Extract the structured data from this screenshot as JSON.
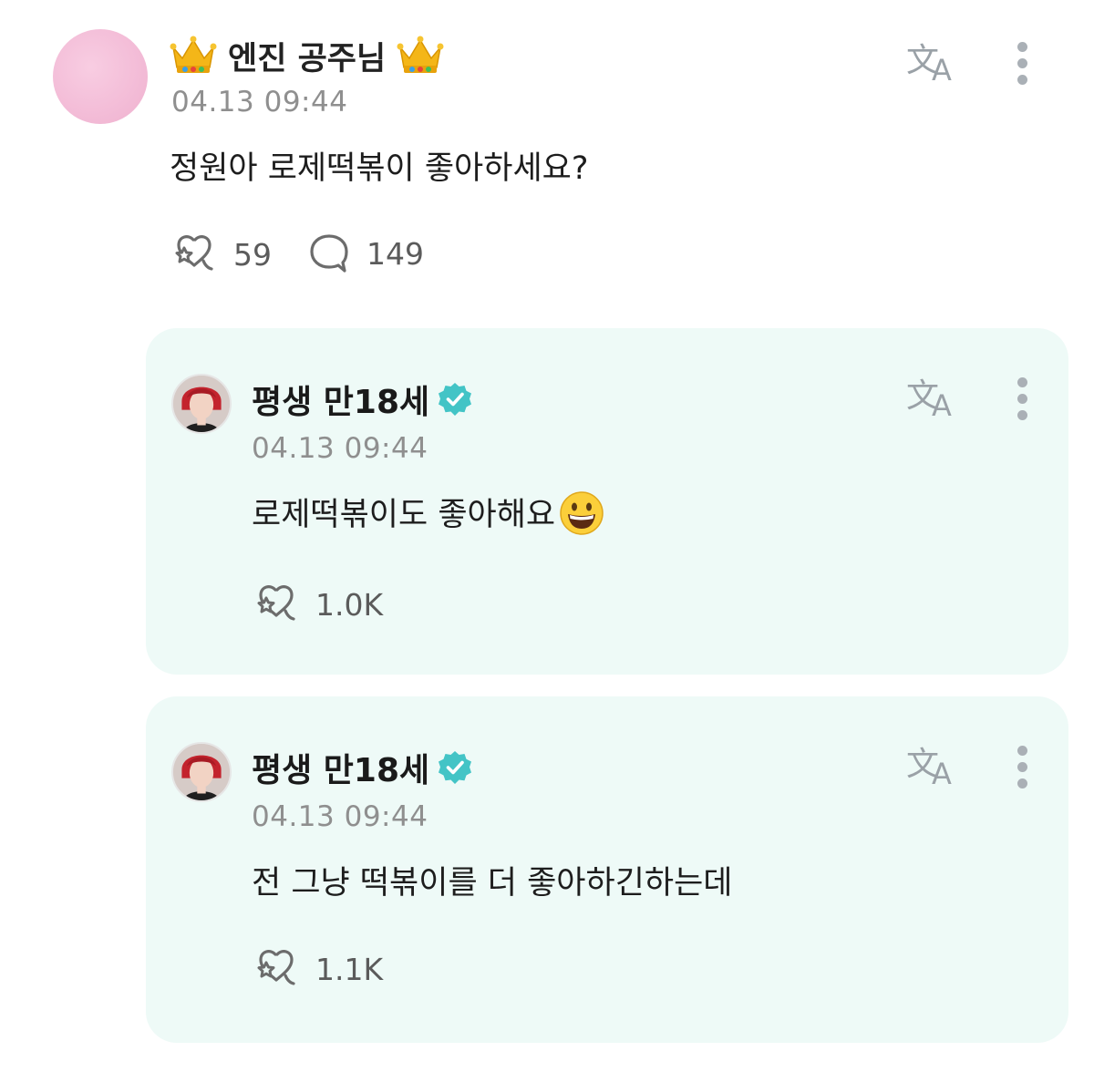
{
  "post": {
    "author": "엔진 공주님",
    "author_icon": "crown-emoji",
    "time": "04.13 09:44",
    "text": "정원아 로제떡볶이 좋아하세요?",
    "likes": "59",
    "comments": "149"
  },
  "replies": [
    {
      "author": "평생 만18세",
      "verified": true,
      "time": "04.13 09:44",
      "text": "로제떡볶이도 좋아해요",
      "emoji": "grinning-face-emoji",
      "likes": "1.0K"
    },
    {
      "author": "평생 만18세",
      "verified": true,
      "time": "04.13 09:44",
      "text": "전 그냥 떡볶이를 더 좋아하긴하는데",
      "likes": "1.1K"
    }
  ],
  "colors": {
    "card_bg": "#eefaf7",
    "verified_badge": "#43c4c6",
    "muted_text": "#8f8f8f",
    "icon_gray": "#aab0b6"
  }
}
